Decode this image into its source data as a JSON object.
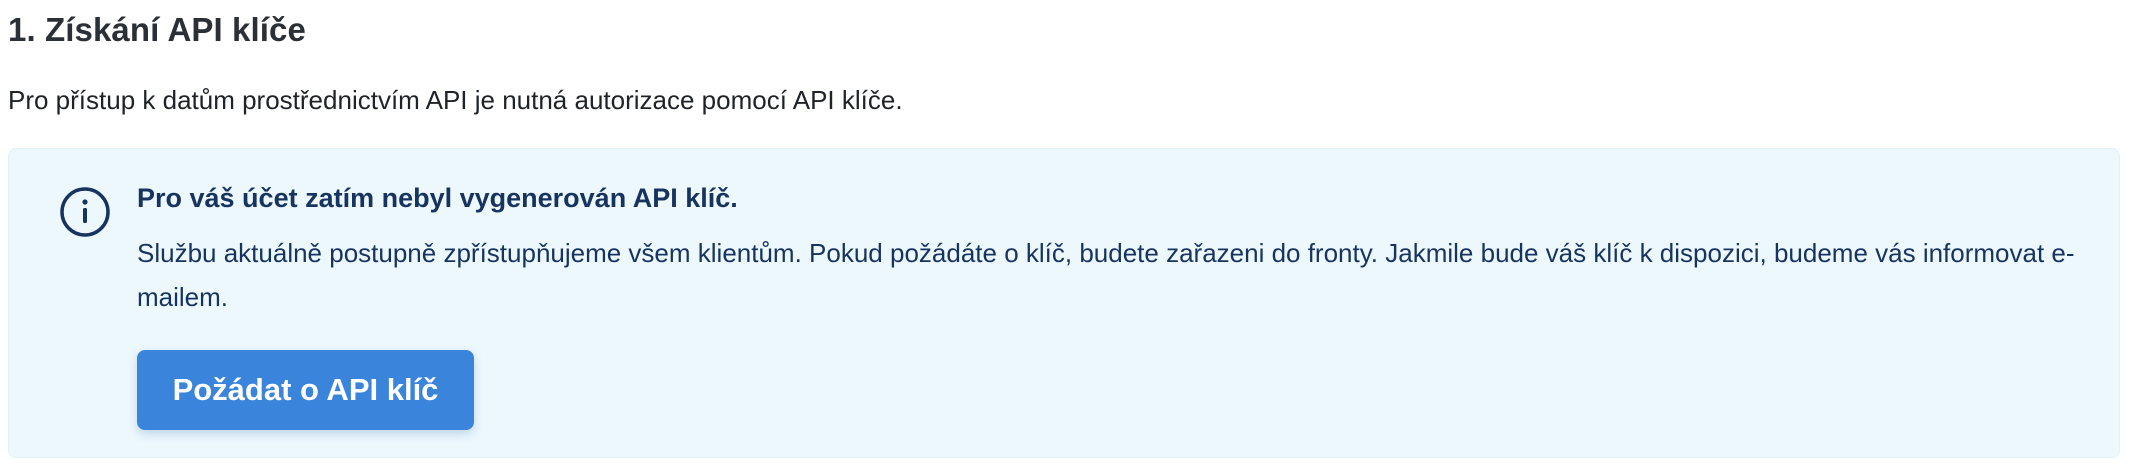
{
  "section": {
    "title": "1. Získání API klíče",
    "intro": "Pro přístup k datům prostřednictvím API je nutná autorizace pomocí API klíče."
  },
  "alert": {
    "icon": "info-icon",
    "title": "Pro váš účet zatím nebyl vygenerován API klíč.",
    "text": "Službu aktuálně postupně zpřístupňujeme všem klientům. Pokud požádáte o klíč, budete zařazeni do fronty. Jakmile bude váš klíč k dispozici, budeme vás informovat e-mailem.",
    "button_label": "Požádat o API klíč"
  },
  "colors": {
    "alert_background": "#edf8fd",
    "alert_text": "#17335f",
    "button_background": "#3b84dc",
    "button_text": "#ffffff"
  }
}
